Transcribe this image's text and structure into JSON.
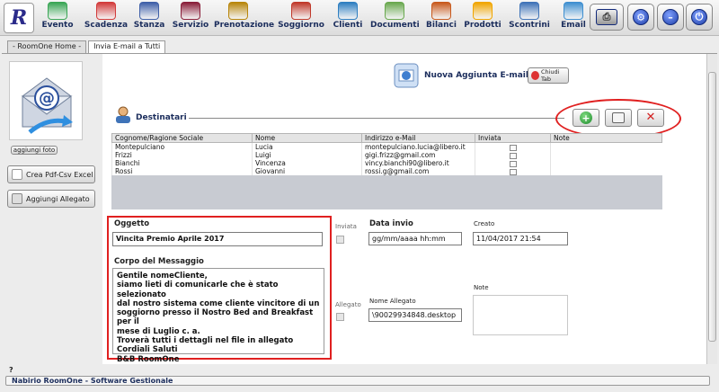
{
  "toolbar": {
    "logo_letter": "R",
    "items": [
      {
        "label": "Evento",
        "icon": "calendar-add-icon",
        "color": "#3aa655"
      },
      {
        "label": "Scadenza",
        "icon": "calendar-alert-icon",
        "color": "#d23b3b"
      },
      {
        "label": "Stanza",
        "icon": "bed-icon",
        "color": "#3f5fa8"
      },
      {
        "label": "Servizio",
        "icon": "shirt-icon",
        "color": "#8a1f3a"
      },
      {
        "label": "Prenotazione",
        "icon": "cake-icon",
        "color": "#b8860b"
      },
      {
        "label": "Soggiorno",
        "icon": "compass-icon",
        "color": "#c0392b"
      },
      {
        "label": "Clienti",
        "icon": "person-icon",
        "color": "#2f7fc1"
      },
      {
        "label": "Documenti",
        "icon": "document-upload-icon",
        "color": "#6aa84f"
      },
      {
        "label": "Bilanci",
        "icon": "ledger-icon",
        "color": "#c85a1e"
      },
      {
        "label": "Prodotti",
        "icon": "shopping-bag-icon",
        "color": "#f0a500"
      },
      {
        "label": "Scontrini",
        "icon": "receipt-icon",
        "color": "#3f73b8"
      },
      {
        "label": "Email",
        "icon": "email-icon",
        "color": "#3f8fd0"
      }
    ],
    "window_buttons": [
      {
        "name": "printer-icon",
        "glyph": "⎙"
      },
      {
        "name": "settings-icon",
        "glyph": "⚙"
      },
      {
        "name": "minimize-icon",
        "glyph": "–"
      },
      {
        "name": "power-icon",
        "glyph": "⏻"
      }
    ]
  },
  "tabs": [
    {
      "label": "- RoomOne Home -"
    },
    {
      "label": "Invia E-mail a Tutti"
    }
  ],
  "left": {
    "add_photo_label": "aggiungi foto",
    "pdf_button_label": "Crea Pdf-Csv Excel",
    "attach_button_label": "Aggiungi Allegato"
  },
  "header": {
    "title": "Nuova Aggiunta E-mail",
    "close_tab_label": "Chiudi Tab"
  },
  "recipients": {
    "title": "Destinatari",
    "columns": [
      "Cognome/Ragione Sociale",
      "Nome",
      "Indirizzo e-Mail",
      "Inviata",
      "Note"
    ],
    "rows": [
      {
        "surname": "Montepulciano",
        "name": "Lucia",
        "email": "montepulciano.lucia@libero.it",
        "note": ""
      },
      {
        "surname": "Frizzi",
        "name": "Luigi",
        "email": "gigi.frizz@gmail.com",
        "note": ""
      },
      {
        "surname": "Bianchi",
        "name": "Vincenza",
        "email": "vincy.bianchi90@libero.it",
        "note": ""
      },
      {
        "surname": "Rossi",
        "name": "Giovanni",
        "email": "rossi.g@gmail.com",
        "note": ""
      }
    ]
  },
  "form": {
    "subject_label": "Oggetto",
    "subject_value": "Vincita Premio Aprile 2017",
    "body_label": "Corpo del Messaggio",
    "body_value": "Gentile nomeCliente,\nsiamo lieti di comunicarle che è stato selezionato\ndal nostro sistema come cliente vincitore di un\nsoggiorno presso il Nostro Bed and Breakfast per il\nmese di Luglio c. a.\nTroverà tutti i dettagli nel file in allegato\nCordiali Saluti\nB&B RoomOne",
    "sent_label": "Inviata",
    "send_date_label": "Data invio",
    "send_date_value": "gg/mm/aaaa hh:mm",
    "created_label": "Creato",
    "created_value": "11/04/2017 21:54",
    "attached_label": "Allegato",
    "attachment_name_label": "Nome Allegato",
    "attachment_name_value": "\\90029934848.desktop",
    "note_label": "Note"
  },
  "status": {
    "help": "?",
    "text": "Nabirio RoomOne - Software Gestionale"
  }
}
